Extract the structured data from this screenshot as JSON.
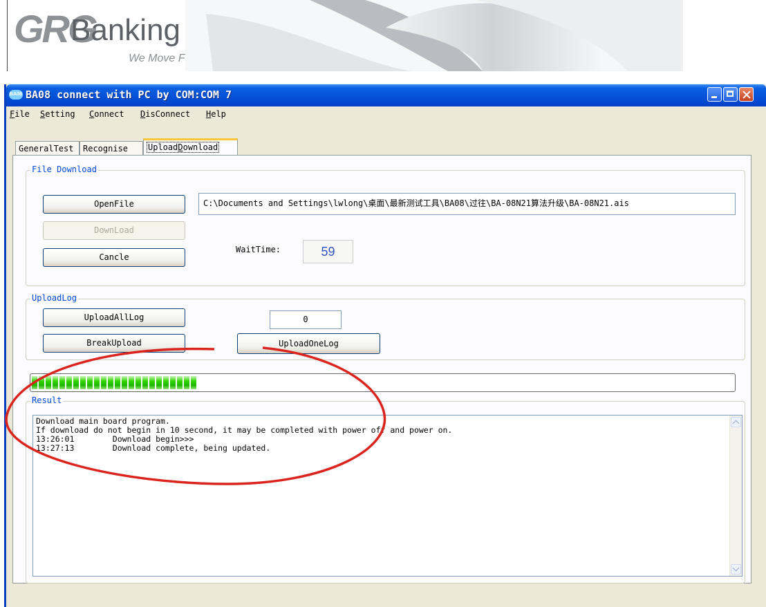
{
  "banner": {
    "logo_grg": "GRG",
    "logo_banking": "Banking",
    "slogan": "We Move Faster"
  },
  "window": {
    "app_icon": "BA08",
    "title": "BA08 connect with PC by COM:COM 7",
    "menu": [
      {
        "accel": "F",
        "rest": "ile"
      },
      {
        "accel": "S",
        "rest": "etting"
      },
      {
        "accel": "C",
        "rest": "onnect"
      },
      {
        "accel": "D",
        "rest": "isConnect"
      },
      {
        "accel": "H",
        "rest": "elp"
      }
    ],
    "tabs": [
      {
        "label": "GeneralTest"
      },
      {
        "label": "Recognise"
      },
      {
        "pre": "Upload",
        "accel": "D",
        "post": "ownload"
      }
    ]
  },
  "file_download": {
    "group_label": "File Download",
    "open_file": "OpenFile",
    "download": "DownLoad",
    "cancel": "Cancle",
    "path_value": "C:\\Documents and Settings\\lwlong\\桌面\\最新测试工具\\BA08\\过往\\BA-08N21算法升级\\BA-08N21.ais",
    "wait_time_label": "WaitTime:",
    "wait_time_value": "59"
  },
  "upload_log": {
    "group_label": "UploadLog",
    "upload_all": "UploadAllLog",
    "break_upload": "BreakUpload",
    "upload_one": "UploadOneLog",
    "log_index_value": "0"
  },
  "progress": {
    "fraction": 0.24
  },
  "result": {
    "group_label": "Result",
    "lines": "Download main board program.\nIf download do not begin in 10 second, it may be completed with power off and power on.\n13:26:01        Download begin>>>\n13:27:13        Download complete, being updated."
  },
  "colors": {
    "annotation": "#d9251d",
    "progress": "#2bd600",
    "title_bar": "#0550d6"
  }
}
